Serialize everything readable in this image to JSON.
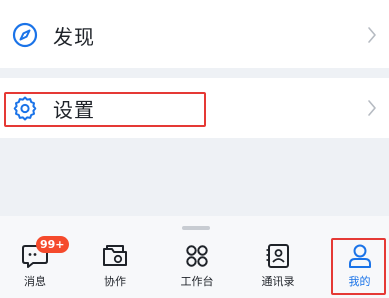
{
  "menu": {
    "discover": {
      "label": "发现",
      "icon": "compass-icon"
    },
    "settings": {
      "label": "设置",
      "icon": "gear-icon"
    }
  },
  "tabbar": {
    "tabs": [
      {
        "label": "消息",
        "icon": "message-icon",
        "badge": "99+"
      },
      {
        "label": "协作",
        "icon": "collab-folder-icon"
      },
      {
        "label": "工作台",
        "icon": "workbench-grid-icon"
      },
      {
        "label": "通讯录",
        "icon": "contacts-icon"
      },
      {
        "label": "我的",
        "icon": "person-icon",
        "active": true
      }
    ]
  },
  "colors": {
    "accent": "#1a73e8",
    "highlight": "#e53935",
    "badge": "#f54a2c",
    "text": "#1f2329",
    "background": "#eef1f5"
  }
}
